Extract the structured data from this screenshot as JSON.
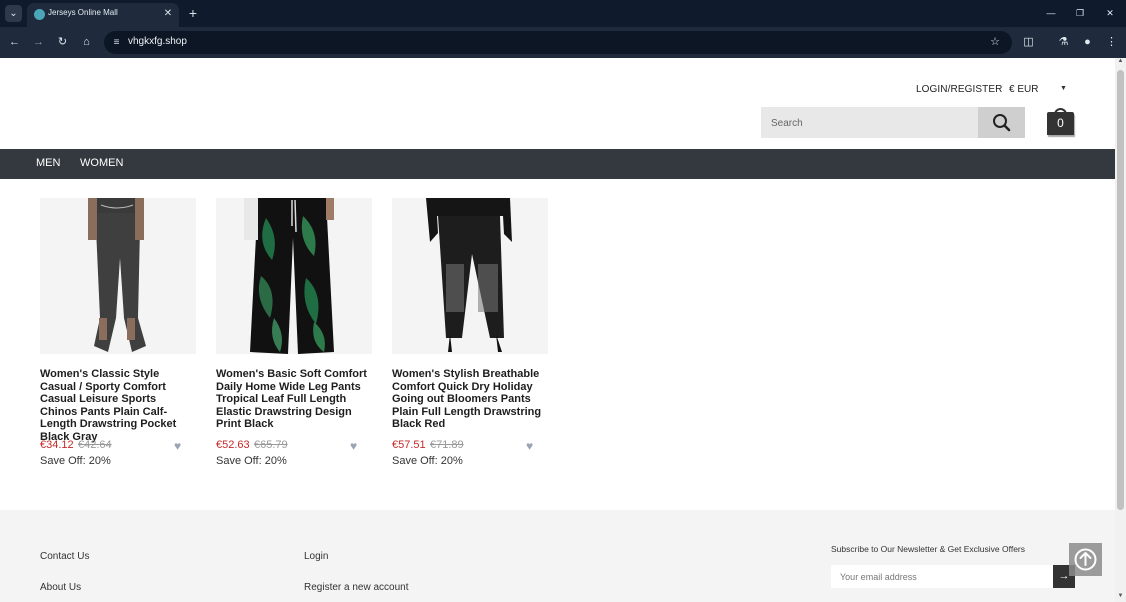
{
  "browser": {
    "tab_title": "Jerseys Online Mall",
    "url": "vhgkxfg.shop",
    "icons": {
      "tab_menu": "chevron-down-icon",
      "new_tab": "plus-icon",
      "back": "arrow-left-icon",
      "forward": "arrow-right-icon",
      "reload": "reload-icon",
      "home": "home-icon",
      "site_info": "site-info-icon",
      "bookmark": "star-icon",
      "extensions": "puzzle-icon",
      "labs": "flask-icon",
      "profile": "profile-icon",
      "menu": "kebab-menu-icon"
    }
  },
  "header": {
    "login_register": "LOGIN/REGISTER",
    "currency": "€ EUR",
    "search_placeholder": "Search",
    "cart_count": "0"
  },
  "nav": {
    "items": [
      {
        "label": "MEN"
      },
      {
        "label": "WOMEN"
      }
    ]
  },
  "products": [
    {
      "name": "Women's Classic Style Casual / Sporty Comfort Casual Leisure Sports Chinos Pants Plain Calf-Length Drawstring Pocket Black Gray",
      "price_now": "€34.12",
      "price_old": "€42.64",
      "save": "Save Off: 20%"
    },
    {
      "name": "Women's Basic Soft Comfort Daily Home Wide Leg Pants Tropical Leaf Full Length Elastic Drawstring Design Print Black",
      "price_now": "€52.63",
      "price_old": "€65.79",
      "save": "Save Off: 20%"
    },
    {
      "name": "Women's Stylish Breathable Comfort Quick Dry Holiday Going out Bloomers Pants Plain Full Length Drawstring Black Red",
      "price_now": "€57.51",
      "price_old": "€71.89",
      "save": "Save Off: 20%"
    }
  ],
  "footer": {
    "links_col1": [
      "Contact Us",
      "About Us"
    ],
    "links_col2": [
      "Login",
      "Register a new account"
    ],
    "newsletter_label": "Subscribe to Our Newsletter & Get Exclusive Offers",
    "email_placeholder": "Your email address"
  },
  "colors": {
    "price_red": "#c62828",
    "nav_bg": "#34393f",
    "browser_bg": "#1f2b3c"
  }
}
